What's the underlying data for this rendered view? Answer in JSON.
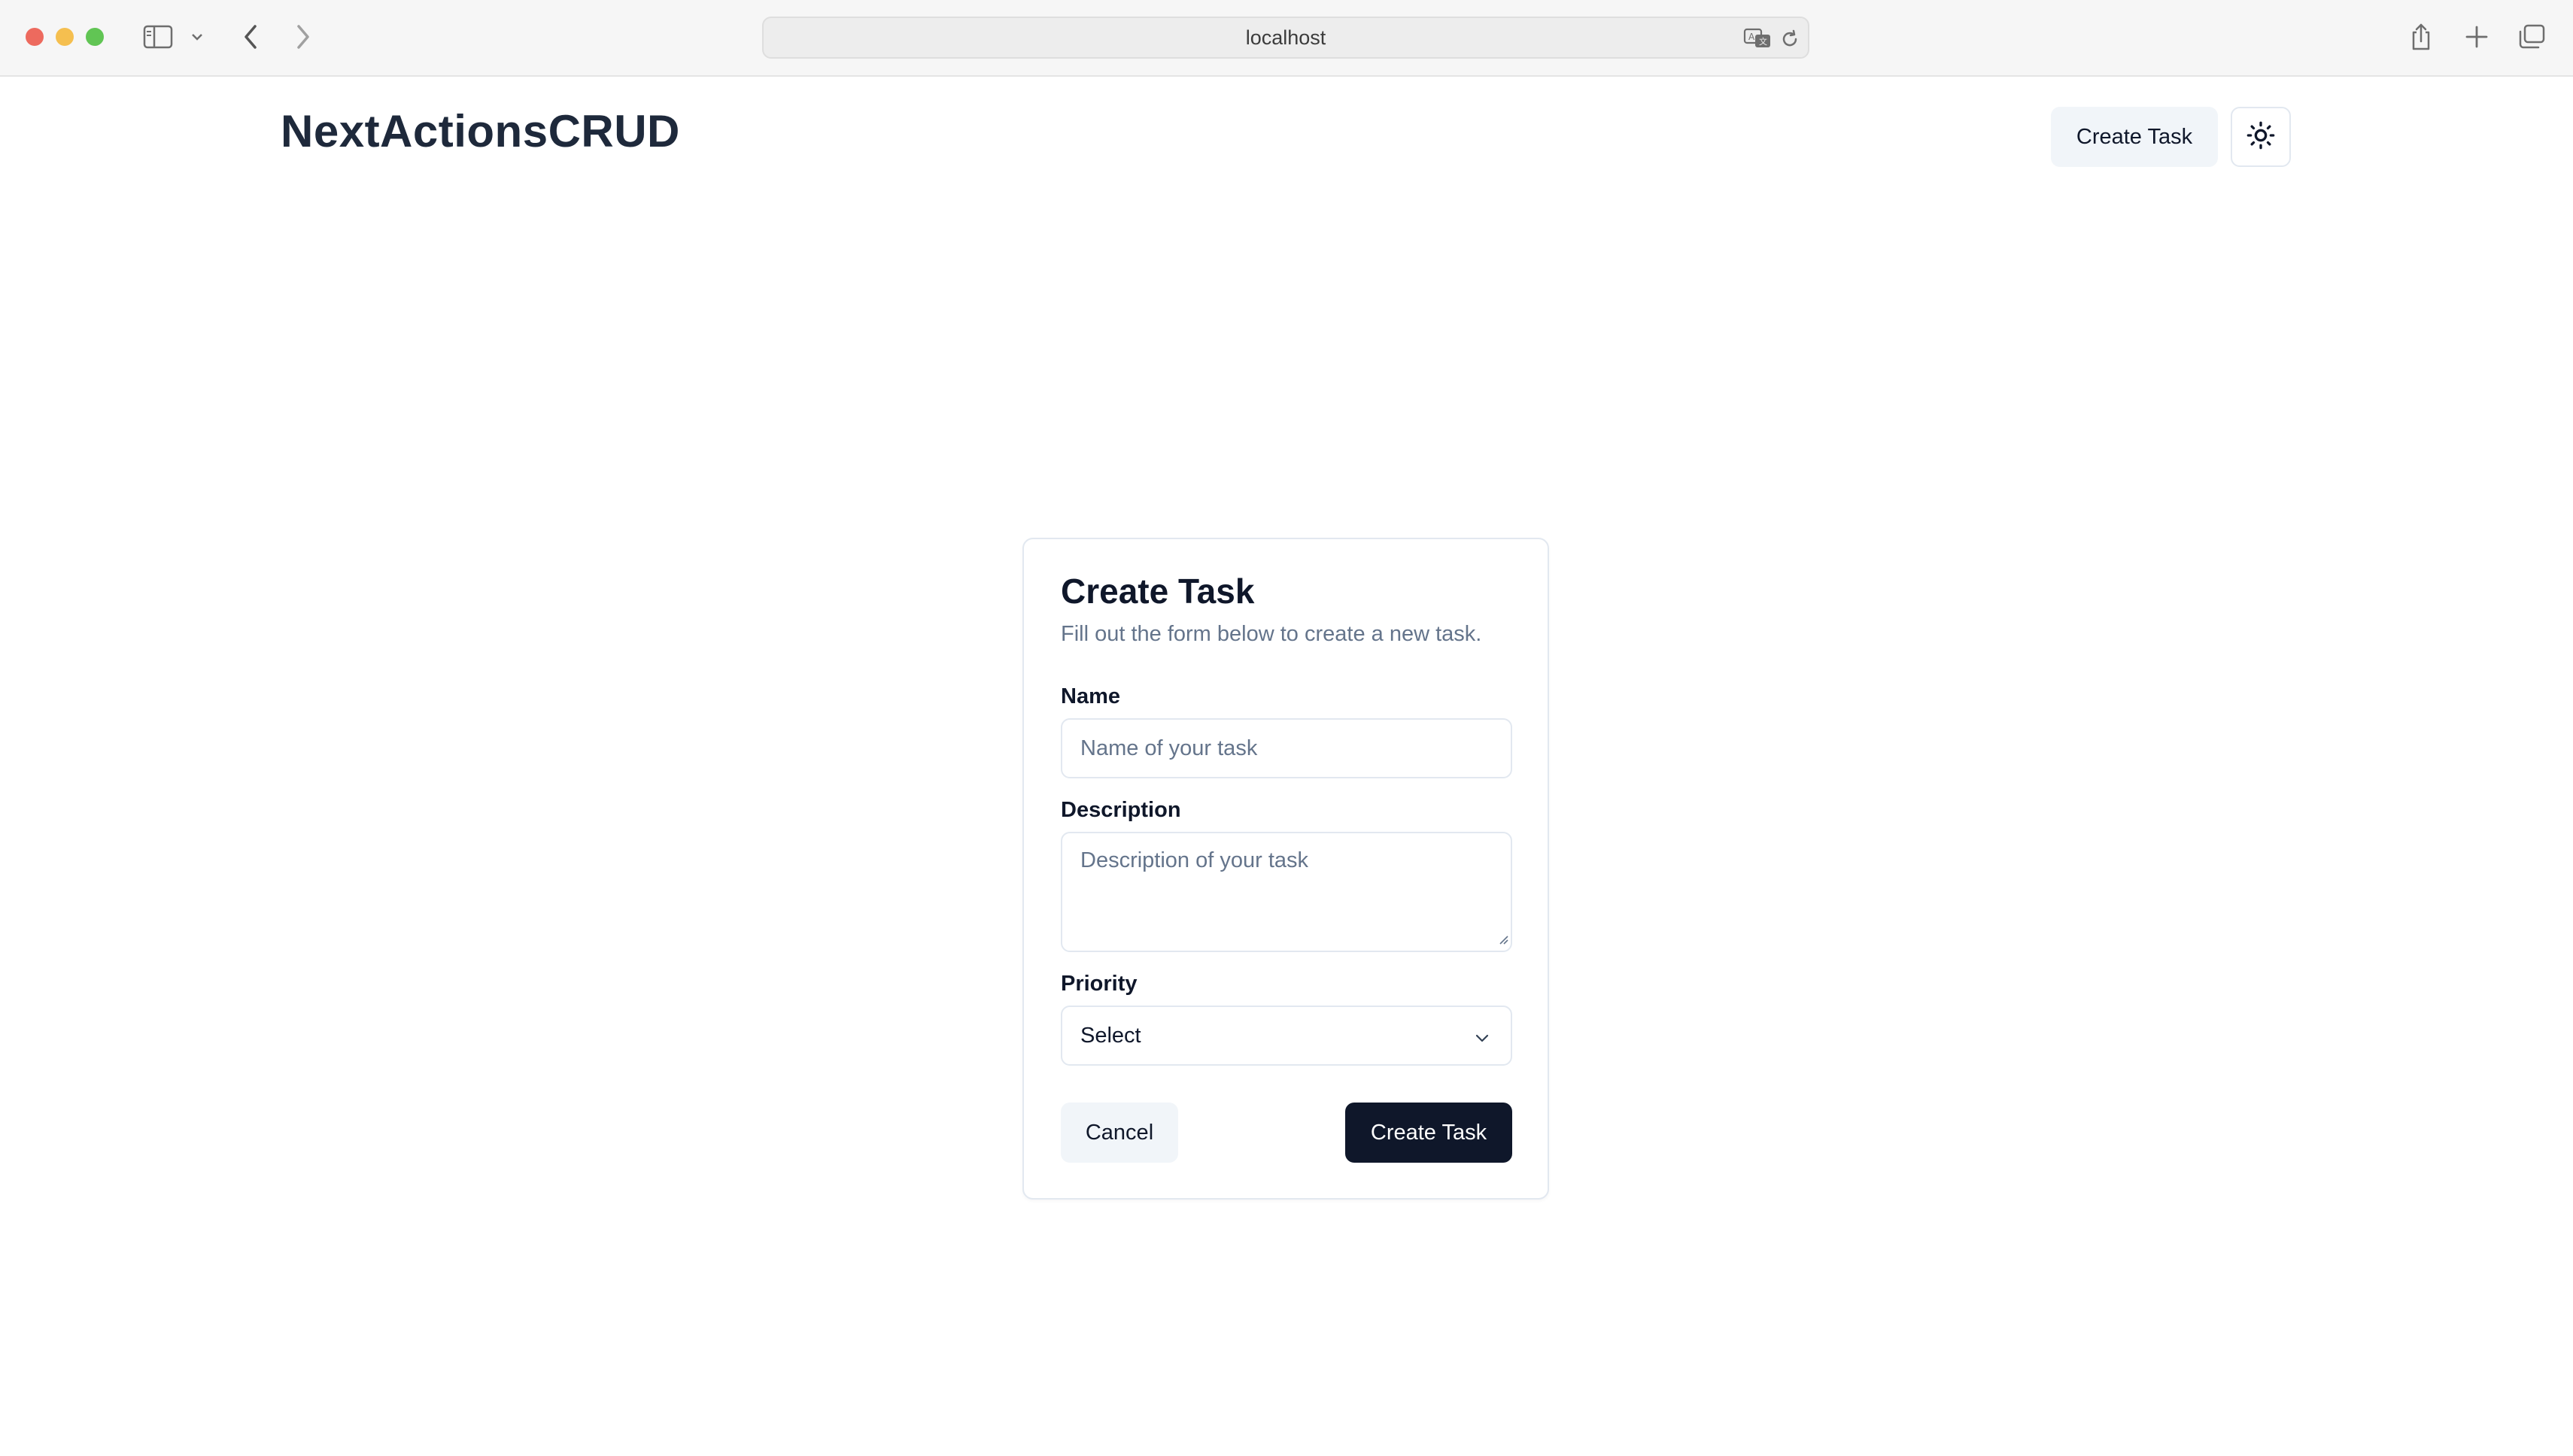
{
  "browser": {
    "url": "localhost"
  },
  "header": {
    "app_title": "NextActionsCRUD",
    "create_task_label": "Create Task"
  },
  "form": {
    "title": "Create Task",
    "description": "Fill out the form below to create a new task.",
    "name_label": "Name",
    "name_placeholder": "Name of your task",
    "description_label": "Description",
    "description_placeholder": "Description of your task",
    "priority_label": "Priority",
    "priority_value": "Select",
    "cancel_label": "Cancel",
    "submit_label": "Create Task"
  },
  "colors": {
    "primary": "#0f172a",
    "muted_bg": "#f1f5f9",
    "border": "#e2e8f0",
    "muted_text": "#64748b"
  }
}
